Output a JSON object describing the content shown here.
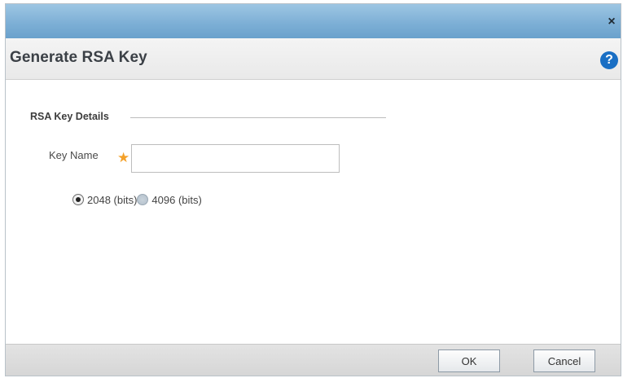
{
  "titlebar": {
    "close_icon": "close-icon",
    "close_glyph": "×"
  },
  "dialog": {
    "title": "Generate RSA Key",
    "help_icon": "help-icon",
    "help_glyph": "?"
  },
  "section": {
    "title": "RSA Key Details"
  },
  "key_name": {
    "label": "Key Name",
    "required_mark": "★",
    "value": "",
    "placeholder": ""
  },
  "key_size": {
    "selected": "2048 (bits)",
    "options": [
      {
        "label": "2048 (bits)",
        "selected": true
      },
      {
        "label": "4096 (bits)",
        "selected": false
      }
    ]
  },
  "footer": {
    "ok_label": "OK",
    "cancel_label": "Cancel"
  },
  "colors": {
    "titlebar": "#7eb0d6",
    "help_icon": "#1a6fc4",
    "required_star": "#f4a12a"
  }
}
